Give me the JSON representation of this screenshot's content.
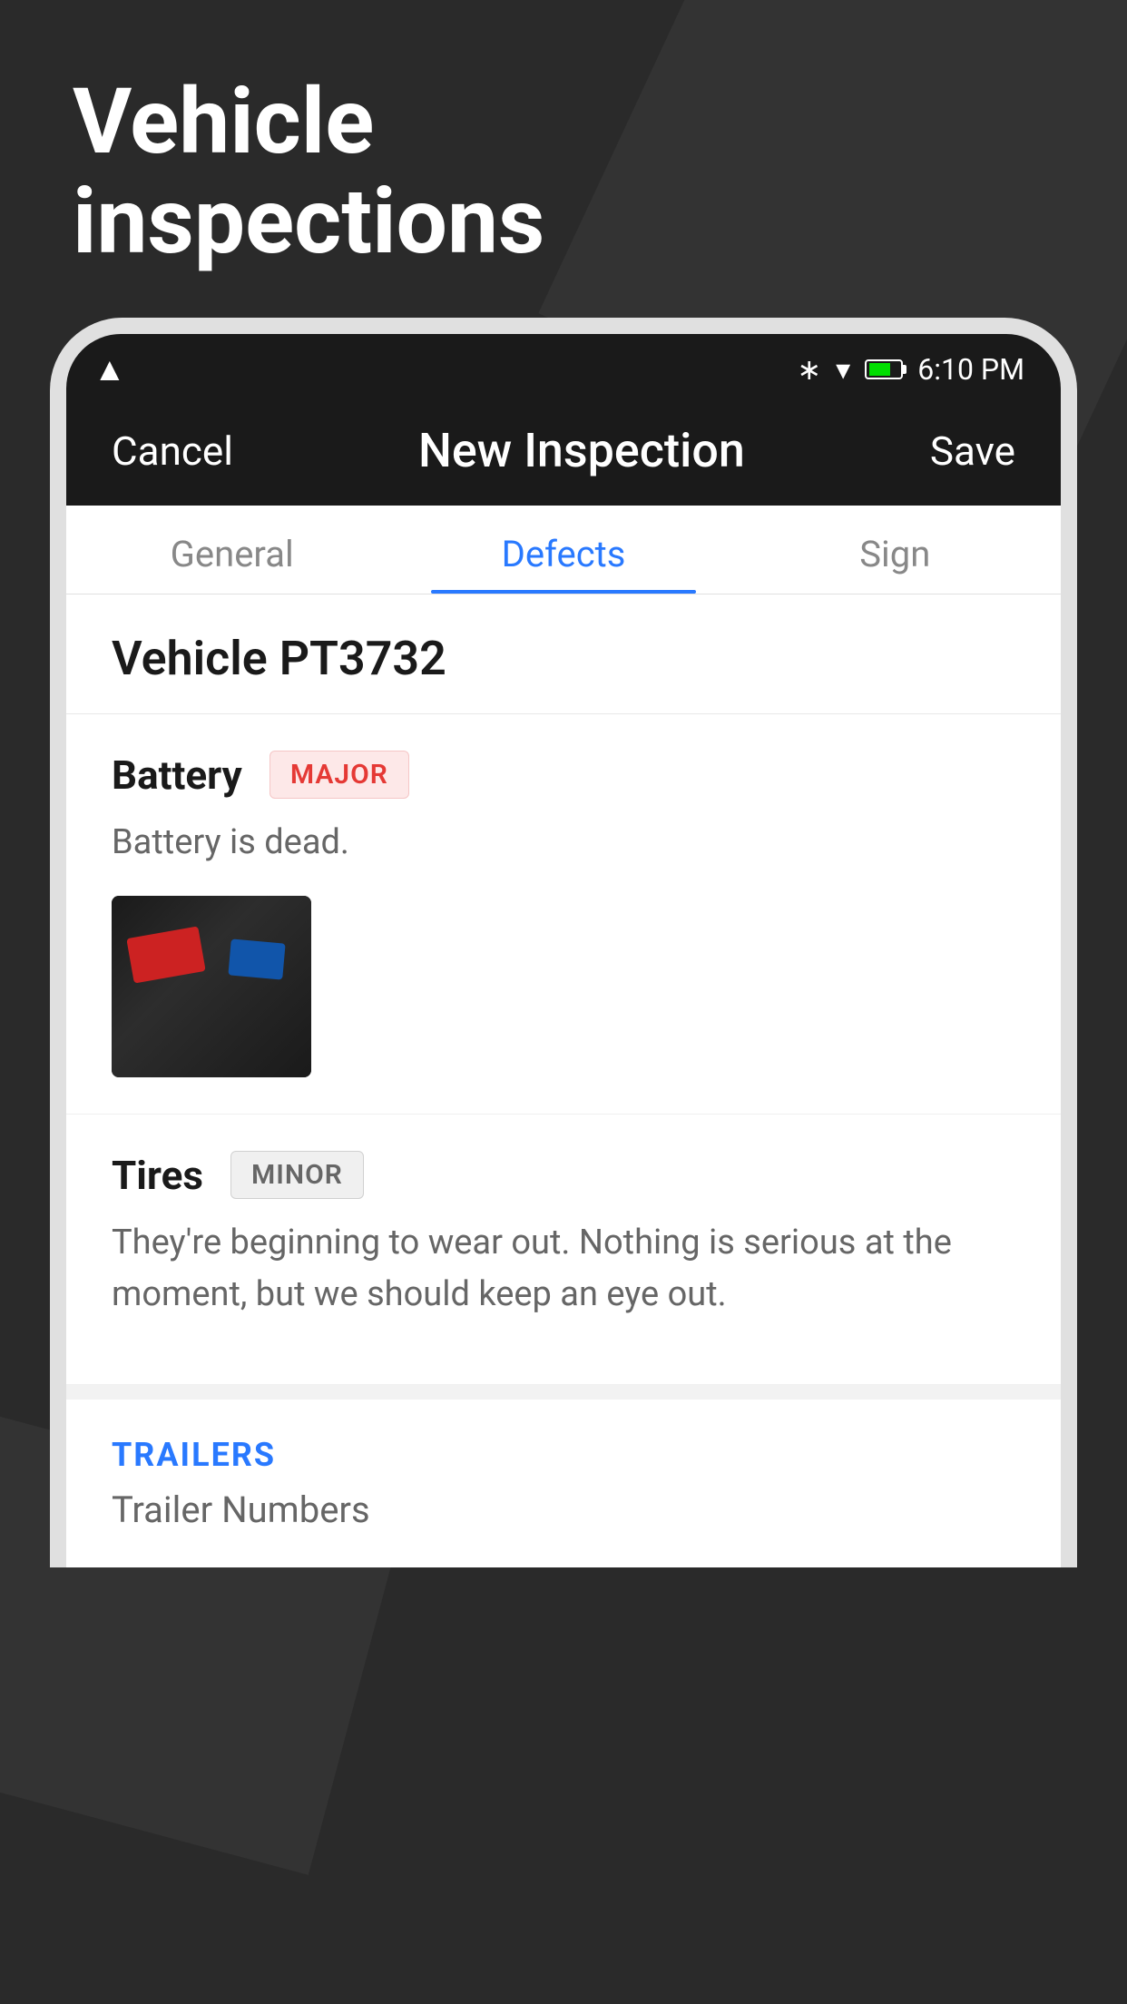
{
  "page": {
    "title_line1": "Vehicle",
    "title_line2": "inspections",
    "background_color": "#2a2a2a"
  },
  "status_bar": {
    "time": "6:10 PM",
    "am_pm": "PM"
  },
  "nav": {
    "cancel_label": "Cancel",
    "title": "New Inspection",
    "save_label": "Save"
  },
  "tabs": [
    {
      "id": "general",
      "label": "General",
      "active": false
    },
    {
      "id": "defects",
      "label": "Defects",
      "active": true
    },
    {
      "id": "sign",
      "label": "Sign",
      "active": false
    }
  ],
  "vehicle": {
    "name": "Vehicle PT3732"
  },
  "defects": [
    {
      "id": "battery",
      "name": "Battery",
      "severity": "MAJOR",
      "severity_type": "major",
      "description": "Battery is dead.",
      "has_image": true
    },
    {
      "id": "tires",
      "name": "Tires",
      "severity": "MINOR",
      "severity_type": "minor",
      "description": "They're beginning to wear out. Nothing is serious at the moment, but we should keep an eye out.",
      "has_image": false
    }
  ],
  "trailers": {
    "section_label": "TRAILERS",
    "subtitle": "Trailer Numbers"
  }
}
